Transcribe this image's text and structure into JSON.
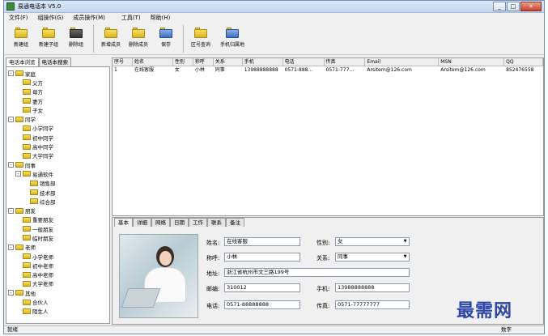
{
  "window": {
    "title": "易通电话本 V5.0",
    "min": "_",
    "max": "□",
    "close": "✕"
  },
  "menu": [
    "文件(F)",
    "组操作(G)",
    "成员操作(M)",
    "工具(T)",
    "帮助(H)"
  ],
  "toolbar": [
    {
      "label": "新建组",
      "icon": "new-group-icon"
    },
    {
      "label": "新建子组",
      "icon": "new-subgroup-icon"
    },
    {
      "label": "删除组",
      "icon": "delete-group-icon"
    },
    {
      "label": "新增成员",
      "icon": "add-member-icon"
    },
    {
      "label": "删除成员",
      "icon": "delete-member-icon"
    },
    {
      "label": "保存",
      "icon": "save-icon"
    },
    {
      "label": "区号查询",
      "icon": "area-code-icon"
    },
    {
      "label": "手机归属地",
      "icon": "mobile-location-icon"
    }
  ],
  "left_tabs": [
    "电话本浏览",
    "电话本搜索"
  ],
  "tree": [
    {
      "label": "家庭",
      "level": 0,
      "expander": "-"
    },
    {
      "label": "父方",
      "level": 1
    },
    {
      "label": "母方",
      "level": 1
    },
    {
      "label": "妻方",
      "level": 1
    },
    {
      "label": "子女",
      "level": 1
    },
    {
      "label": "同学",
      "level": 0,
      "expander": "-"
    },
    {
      "label": "小学同学",
      "level": 1
    },
    {
      "label": "初中同学",
      "level": 1
    },
    {
      "label": "高中同学",
      "level": 1
    },
    {
      "label": "大学同学",
      "level": 1
    },
    {
      "label": "同事",
      "level": 0,
      "expander": "-"
    },
    {
      "label": "易通软件",
      "level": 1,
      "expander": "-"
    },
    {
      "label": "销售部",
      "level": 2
    },
    {
      "label": "技术部",
      "level": 2
    },
    {
      "label": "综合部",
      "level": 2
    },
    {
      "label": "朋友",
      "level": 0,
      "expander": "-"
    },
    {
      "label": "重要朋友",
      "level": 1
    },
    {
      "label": "一般朋友",
      "level": 1
    },
    {
      "label": "临时朋友",
      "level": 1
    },
    {
      "label": "老师",
      "level": 0,
      "expander": "-"
    },
    {
      "label": "小学老师",
      "level": 1
    },
    {
      "label": "初中老师",
      "level": 1
    },
    {
      "label": "高中老师",
      "level": 1
    },
    {
      "label": "大学老师",
      "level": 1
    },
    {
      "label": "其他",
      "level": 0,
      "expander": "-"
    },
    {
      "label": "合伙人",
      "level": 1
    },
    {
      "label": "陌生人",
      "level": 1
    }
  ],
  "grid": {
    "columns": [
      "序号",
      "姓名",
      "性别",
      "称呼",
      "关系",
      "手机",
      "电话",
      "传真",
      "Email",
      "MSN",
      "QQ"
    ],
    "rows": [
      [
        "1",
        "在线客服",
        "女",
        "小林",
        "同事",
        "13988888888",
        "0571-888...",
        "0571-777...",
        "Arsitem@126.com",
        "Arsitem@126.com",
        "852476558"
      ]
    ]
  },
  "detail_tabs": [
    "基本",
    "详细",
    "网络",
    "日期",
    "工作",
    "联系",
    "备注"
  ],
  "detail": {
    "name_label": "姓名:",
    "name": "在线客服",
    "gender_label": "性别:",
    "gender": "女",
    "nick_label": "称呼:",
    "nick": "小林",
    "relation_label": "关系:",
    "relation": "同事",
    "address_label": "地址:",
    "address": "浙江省杭州市文三路199号",
    "zip_label": "邮编:",
    "zip": "310012",
    "mobile_label": "手机:",
    "mobile": "13988888888",
    "phone_label": "电话:",
    "phone": "0571-88888888",
    "fax_label": "传真:",
    "fax": "0571-77777777"
  },
  "status": {
    "left": "就绪",
    "right": "数字"
  },
  "watermark": "最需网"
}
